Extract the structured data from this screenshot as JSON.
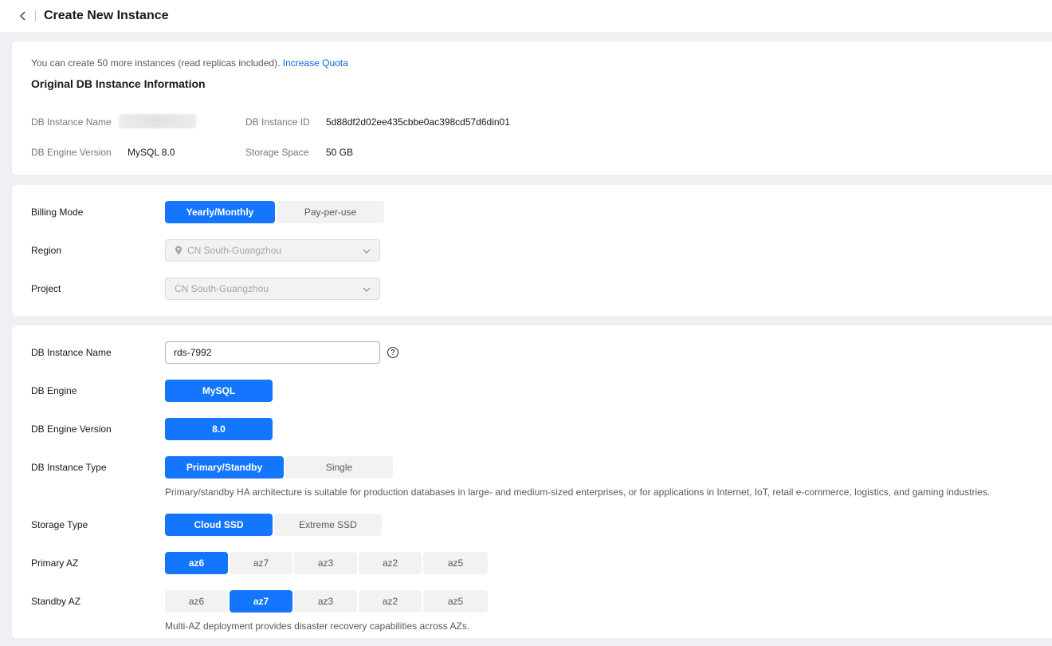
{
  "header": {
    "title": "Create New Instance"
  },
  "quota": {
    "text": "You can create 50 more instances (read replicas included).",
    "link": "Increase Quota"
  },
  "original": {
    "section_title": "Original DB Instance Information",
    "name_label": "DB Instance Name",
    "id_label": "DB Instance ID",
    "id_value": "5d88df2d02ee435cbbe0ac398cd57d6din01",
    "version_label": "DB Engine Version",
    "version_value": "MySQL 8.0",
    "storage_label": "Storage Space",
    "storage_value": "50 GB"
  },
  "billing": {
    "label": "Billing Mode",
    "options": [
      "Yearly/Monthly",
      "Pay-per-use"
    ],
    "selected": "Yearly/Monthly"
  },
  "region": {
    "label": "Region",
    "value": "CN South-Guangzhou"
  },
  "project": {
    "label": "Project",
    "value": "CN South-Guangzhou"
  },
  "instance_name": {
    "label": "DB Instance Name",
    "value": "rds-7992"
  },
  "engine": {
    "label": "DB Engine",
    "options": [
      "MySQL"
    ],
    "selected": "MySQL"
  },
  "engine_version": {
    "label": "DB Engine Version",
    "options": [
      "8.0"
    ],
    "selected": "8.0"
  },
  "instance_type": {
    "label": "DB Instance Type",
    "options": [
      "Primary/Standby",
      "Single"
    ],
    "selected": "Primary/Standby",
    "hint": "Primary/standby HA architecture is suitable for production databases in large- and medium-sized enterprises, or for applications in Internet, IoT, retail e-commerce, logistics, and gaming industries."
  },
  "storage_type": {
    "label": "Storage Type",
    "options": [
      "Cloud SSD",
      "Extreme SSD"
    ],
    "selected": "Cloud SSD"
  },
  "primary_az": {
    "label": "Primary AZ",
    "options": [
      "az6",
      "az7",
      "az3",
      "az2",
      "az5"
    ],
    "selected": "az6"
  },
  "standby_az": {
    "label": "Standby AZ",
    "options": [
      "az6",
      "az7",
      "az3",
      "az2",
      "az5"
    ],
    "selected": "az7",
    "hint": "Multi-AZ deployment provides disaster recovery capabilities across AZs."
  },
  "colors": {
    "accent": "#1476ff",
    "link": "#0a66d9",
    "page_bg": "#eff0f3"
  },
  "icons": {
    "back": "chevron-left-icon",
    "pin": "location-pin-icon",
    "dropdown": "chevron-down-icon",
    "help": "question-circle-icon"
  }
}
